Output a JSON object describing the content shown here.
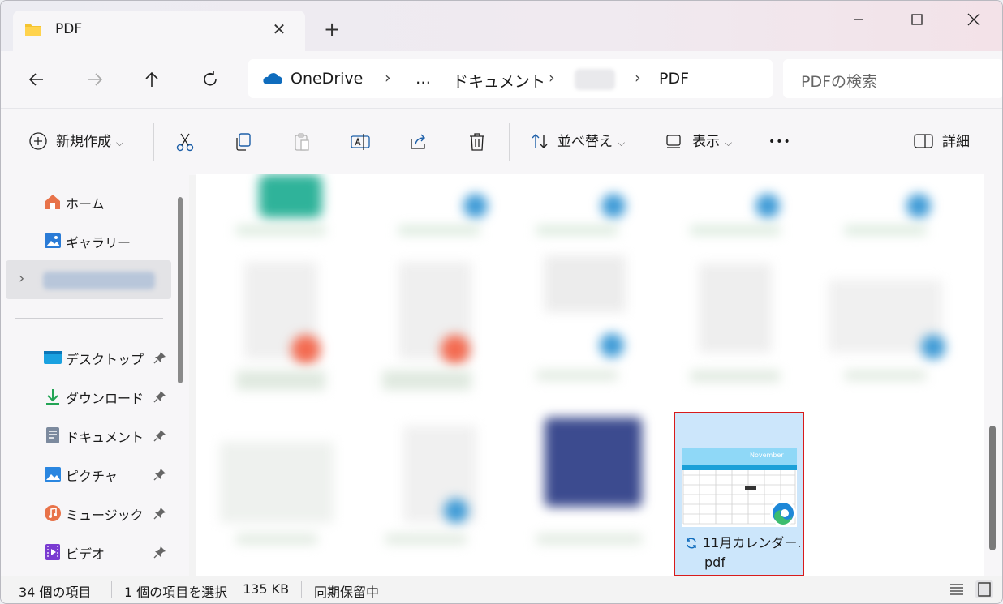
{
  "tab": {
    "title": "PDF",
    "close_glyph": "✕",
    "new_tab_glyph": "+"
  },
  "window_controls": {
    "minimize": "─",
    "maximize": "☐",
    "close": "✕"
  },
  "breadcrumb": {
    "items": [
      "OneDrive",
      "…",
      "ドキュメント",
      "PDF"
    ],
    "separator": "›"
  },
  "search": {
    "placeholder": "PDFの検索"
  },
  "toolbar": {
    "new_label": "新規作成",
    "sort_label": "並べ替え",
    "view_label": "表示",
    "more_label": "•••",
    "details_label": "詳細"
  },
  "sidebar": {
    "items": [
      {
        "label": "ホーム",
        "icon": "home-icon"
      },
      {
        "label": "ギャラリー",
        "icon": "gallery-icon"
      },
      {
        "label": "デスクトップ",
        "icon": "desktop-icon"
      },
      {
        "label": "ダウンロード",
        "icon": "download-icon"
      },
      {
        "label": "ドキュメント",
        "icon": "documents-icon"
      },
      {
        "label": "ピクチャ",
        "icon": "pictures-icon"
      },
      {
        "label": "ミュージック",
        "icon": "music-icon"
      },
      {
        "label": "ビデオ",
        "icon": "videos-icon"
      }
    ],
    "collapsed_glyph": "›"
  },
  "selected_file": {
    "name_line1": "11月カレンダー.",
    "name_line2": "pdf",
    "thumbnail_heading": "November"
  },
  "status": {
    "item_count": "34 個の項目",
    "selection": "1 個の項目を選択",
    "size": "135 KB",
    "sync": "同期保留中"
  },
  "colors": {
    "accent": "#0067c0",
    "selection_bg": "#cce6fb",
    "highlight_border": "#d81b1b",
    "edge_blue": "#1e88d8",
    "edge_green": "#3dbd6f"
  }
}
